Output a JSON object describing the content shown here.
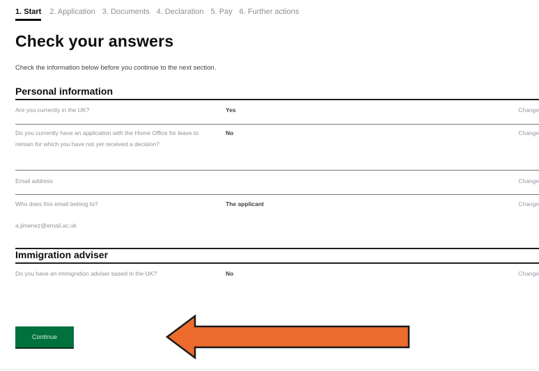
{
  "steps": [
    {
      "label": "1. Start",
      "active": true
    },
    {
      "label": "2. Application",
      "active": false
    },
    {
      "label": "3. Documents",
      "active": false
    },
    {
      "label": "4. Declaration",
      "active": false
    },
    {
      "label": "5. Pay",
      "active": false
    },
    {
      "label": "6. Further actions",
      "active": false
    }
  ],
  "title": "Check your answers",
  "intro": "Check the information below before you continue to the next section.",
  "sections": [
    {
      "heading": "Personal information",
      "rows": [
        {
          "key": "Are you currently in the UK?",
          "value": "Yes",
          "action": "Change"
        },
        {
          "key": "Do you currently have an application with the Home Office for leave to remain for which you have not yet received a decision?",
          "value": "No",
          "action": "Change"
        },
        {
          "key": "Email address",
          "value": "",
          "action": "Change"
        },
        {
          "key": "Who does this email belong to?",
          "value": "The applicant",
          "action": "Change",
          "extra": "a.jimenez@email.ac.uk"
        }
      ]
    },
    {
      "heading": "Immigration adviser",
      "rows": [
        {
          "key": "Do you have an immigration adviser based in the UK?",
          "value": "No",
          "action": "Change"
        }
      ]
    }
  ],
  "continue_label": "Continue",
  "colors": {
    "button": "#00703c",
    "arrow_fill": "#ec6b2d",
    "arrow_stroke": "#1a1a1a"
  },
  "icons": {
    "arrow": "left-arrow-icon"
  }
}
